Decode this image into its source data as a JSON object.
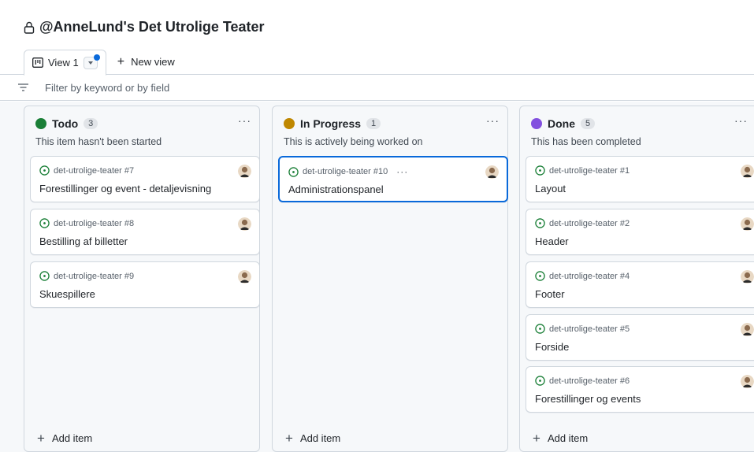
{
  "project": {
    "title": "@AnneLund's Det Utrolige Teater",
    "lock_icon": "lock-icon"
  },
  "tabs": [
    {
      "label": "View 1",
      "icon": "board-icon",
      "active": true
    },
    {
      "label": "New view",
      "icon": "plus-icon"
    }
  ],
  "filter": {
    "placeholder": "Filter by keyword or by field",
    "icon": "filter-icon"
  },
  "colors": {
    "todo": "#1a7f37",
    "in_progress": "#bf8700",
    "done": "#8250df",
    "accent": "#0969da",
    "issue_open": "#1a7f37"
  },
  "columns": [
    {
      "name": "Todo",
      "count": "3",
      "description": "This item hasn't been started",
      "more": "···",
      "add_label": "Add item",
      "cards": [
        {
          "ref": "det-utrolige-teater #7",
          "title": "Forestillinger og event - detaljevisning"
        },
        {
          "ref": "det-utrolige-teater #8",
          "title": "Bestilling af billetter"
        },
        {
          "ref": "det-utrolige-teater #9",
          "title": "Skuespillere"
        }
      ]
    },
    {
      "name": "In Progress",
      "count": "1",
      "description": "This is actively being worked on",
      "more": "···",
      "add_label": "Add item",
      "cards": [
        {
          "ref": "det-utrolige-teater #10",
          "title": "Administrationspanel",
          "more": "···"
        }
      ]
    },
    {
      "name": "Done",
      "count": "5",
      "description": "This has been completed",
      "more": "···",
      "add_label": "Add item",
      "cards": [
        {
          "ref": "det-utrolige-teater #1",
          "title": "Layout"
        },
        {
          "ref": "det-utrolige-teater #2",
          "title": "Header"
        },
        {
          "ref": "det-utrolige-teater #4",
          "title": "Footer"
        },
        {
          "ref": "det-utrolige-teater #5",
          "title": "Forside"
        },
        {
          "ref": "det-utrolige-teater #6",
          "title": "Forestillinger og events"
        }
      ]
    }
  ]
}
